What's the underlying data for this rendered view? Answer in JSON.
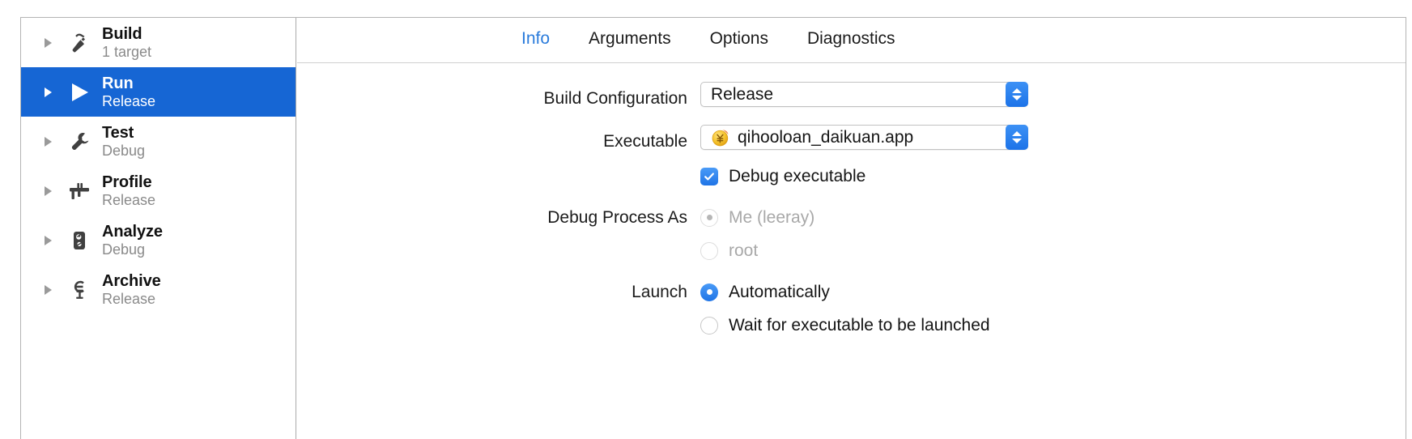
{
  "sidebar": {
    "items": [
      {
        "title": "Build",
        "subtitle": "1 target",
        "icon": "hammer-icon",
        "selected": false
      },
      {
        "title": "Run",
        "subtitle": "Release",
        "icon": "play-icon",
        "selected": true
      },
      {
        "title": "Test",
        "subtitle": "Debug",
        "icon": "wrench-icon",
        "selected": false
      },
      {
        "title": "Profile",
        "subtitle": "Release",
        "icon": "caliper-icon",
        "selected": false
      },
      {
        "title": "Analyze",
        "subtitle": "Debug",
        "icon": "analyze-icon",
        "selected": false
      },
      {
        "title": "Archive",
        "subtitle": "Release",
        "icon": "clamp-icon",
        "selected": false
      }
    ]
  },
  "tabs": [
    {
      "label": "Info",
      "active": true
    },
    {
      "label": "Arguments",
      "active": false
    },
    {
      "label": "Options",
      "active": false
    },
    {
      "label": "Diagnostics",
      "active": false
    }
  ],
  "form": {
    "build_configuration": {
      "label": "Build Configuration",
      "value": "Release"
    },
    "executable": {
      "label": "Executable",
      "value": "qihooloan_daikuan.app",
      "icon": "yen-coin-app-icon"
    },
    "debug_executable": {
      "label": "Debug executable",
      "checked": true
    },
    "debug_process_as": {
      "label": "Debug Process As",
      "options": [
        {
          "label": "Me (leeray)",
          "selected": true,
          "disabled": true
        },
        {
          "label": "root",
          "selected": false,
          "disabled": true
        }
      ]
    },
    "launch": {
      "label": "Launch",
      "options": [
        {
          "label": "Automatically",
          "selected": true,
          "disabled": false
        },
        {
          "label": "Wait for executable to be launched",
          "selected": false,
          "disabled": false
        }
      ]
    }
  },
  "colors": {
    "selection_blue": "#1666d4",
    "tab_active_blue": "#2a7bdb",
    "control_blue": "#1f74e6",
    "subtitle_gray": "#8a8a8a",
    "disabled_gray": "#a8a8a8"
  }
}
